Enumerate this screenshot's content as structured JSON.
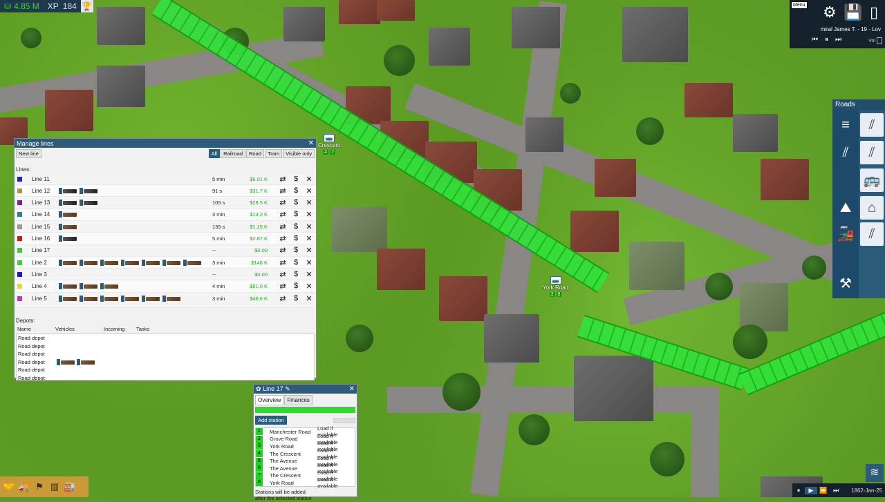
{
  "stats": {
    "money": "4.85 M",
    "xp_label": "XP",
    "xp_value": "184"
  },
  "top_menu": {
    "menu_label": "Menu",
    "music_title": "miral James T. - 19 - Lov",
    "vol_label": "Vol"
  },
  "roads_toolbar": {
    "title": "Roads"
  },
  "stations_on_map": [
    {
      "name": "Crescent",
      "badges": [
        "4",
        "7"
      ]
    },
    {
      "name": "York Road",
      "badges": [
        "3",
        "8"
      ]
    }
  ],
  "manage_lines": {
    "title": "Manage lines",
    "new_line": "New line",
    "filters": [
      "All",
      "Railroad",
      "Road",
      "Tram",
      "Visible only"
    ],
    "active_filter": "All",
    "lines_label": "Lines:",
    "lines": [
      {
        "color": "#2121c8",
        "name": "Line 11",
        "vehicles": 0,
        "time": "5 min",
        "profit": "$6.01 K",
        "clipped": true
      },
      {
        "color": "#a0a020",
        "name": "Line 12",
        "vehicles": 2,
        "vtype": "train",
        "time": "91 s",
        "profit": "$31.7 K"
      },
      {
        "color": "#8a1a8a",
        "name": "Line 13",
        "vehicles": 2,
        "vtype": "train",
        "time": "105 s",
        "profit": "$28.5 K"
      },
      {
        "color": "#1a8a8a",
        "name": "Line 14",
        "vehicles": 1,
        "vtype": "horse",
        "time": "3 min",
        "profit": "$13.2 K"
      },
      {
        "color": "#9a9a9a",
        "name": "Line 15",
        "vehicles": 1,
        "vtype": "horse",
        "time": "135 s",
        "profit": "$1.15 K"
      },
      {
        "color": "#d01818",
        "name": "Line 16",
        "vehicles": 1,
        "vtype": "train",
        "time": "5 min",
        "profit": "$2.87 K"
      },
      {
        "color": "#22dd22",
        "name": "Line 17",
        "vehicles": 0,
        "time": "--",
        "profit": "$0.00"
      },
      {
        "color": "#22dd22",
        "name": "Line 2",
        "vehicles": 7,
        "vtype": "horse",
        "time": "3 min",
        "profit": "$148 K"
      },
      {
        "color": "#1818d0",
        "name": "Line 3",
        "vehicles": 0,
        "time": "--",
        "profit": "$0.00"
      },
      {
        "color": "#e0e010",
        "name": "Line 4",
        "vehicles": 3,
        "vtype": "horse",
        "time": "4 min",
        "profit": "$61.0 K"
      },
      {
        "color": "#e020e0",
        "name": "Line 5",
        "vehicles": 6,
        "vtype": "horse",
        "time": "3 min",
        "profit": "$46.6 K"
      }
    ],
    "depots_label": "Depots:",
    "depot_headers": [
      "Name",
      "Vehicles",
      "Incoming",
      "Tasks"
    ],
    "depots": [
      {
        "name": "Road depot",
        "vehicles": 0
      },
      {
        "name": "Road depot",
        "vehicles": 0
      },
      {
        "name": "Road depot",
        "vehicles": 0
      },
      {
        "name": "Road depot",
        "vehicles": 2
      },
      {
        "name": "Road depot",
        "vehicles": 0
      },
      {
        "name": "Road depot",
        "vehicles": 0
      }
    ]
  },
  "line17_window": {
    "title": "Line 17",
    "tabs": [
      "Overview",
      "Finances"
    ],
    "active_tab": "Overview",
    "add_station": "Add station",
    "stations": [
      {
        "num": "1",
        "name": "Manchester Road",
        "load": "Load if available"
      },
      {
        "num": "2",
        "name": "Grove Road",
        "load": "Load if available"
      },
      {
        "num": "3",
        "name": "York Road",
        "load": "Load if available"
      },
      {
        "num": "4",
        "name": "The Crescent",
        "load": "Load if available"
      },
      {
        "num": "5",
        "name": "The Avenue",
        "load": "Load if available"
      },
      {
        "num": "6",
        "name": "The Avenue",
        "load": "Load if available"
      },
      {
        "num": "7",
        "name": "The Crescent",
        "load": "Load if available"
      },
      {
        "num": "8",
        "name": "York Road",
        "load": "Load if available"
      }
    ],
    "note_line1": "Stations will be added",
    "note_line2": "after the selected station"
  },
  "time_bar": {
    "date": "1862-Jan-25"
  },
  "colors": {
    "ui_dark": "#2b5c7c",
    "profit_green": "#22aa22",
    "line_green": "#22dd22",
    "menu_bg": "#14202c",
    "toolbar_gold": "#c89a38"
  }
}
